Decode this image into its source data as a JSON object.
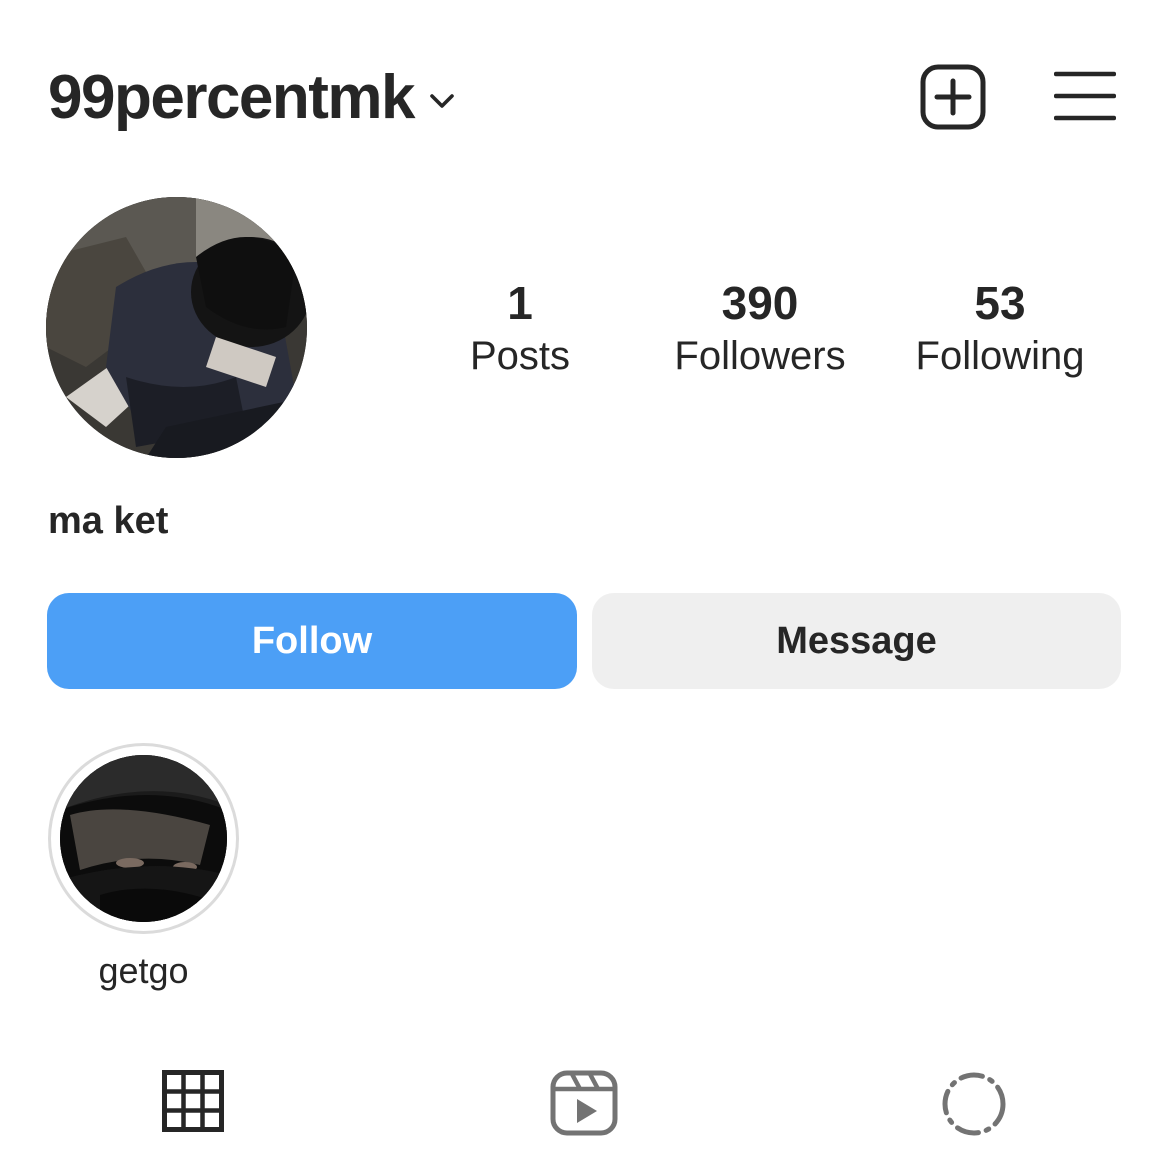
{
  "header": {
    "username": "99percentmk",
    "icons": {
      "dropdown": "chevron-down-icon",
      "new_post": "new-post-icon",
      "menu": "hamburger-menu-icon"
    }
  },
  "profile": {
    "full_name": "ma ket",
    "avatar": "profile-photo"
  },
  "stats": {
    "posts": {
      "value": "1",
      "label": "Posts"
    },
    "followers": {
      "value": "390",
      "label": "Followers"
    },
    "following": {
      "value": "53",
      "label": "Following"
    }
  },
  "actions": {
    "follow_label": "Follow",
    "message_label": "Message",
    "follow_color": "#4c9ff6",
    "message_color": "#efefef"
  },
  "highlights": [
    {
      "label": "getgo"
    }
  ],
  "tabs": {
    "grid": "grid-icon",
    "reels": "reels-icon",
    "tagged": "tagged-icon"
  }
}
